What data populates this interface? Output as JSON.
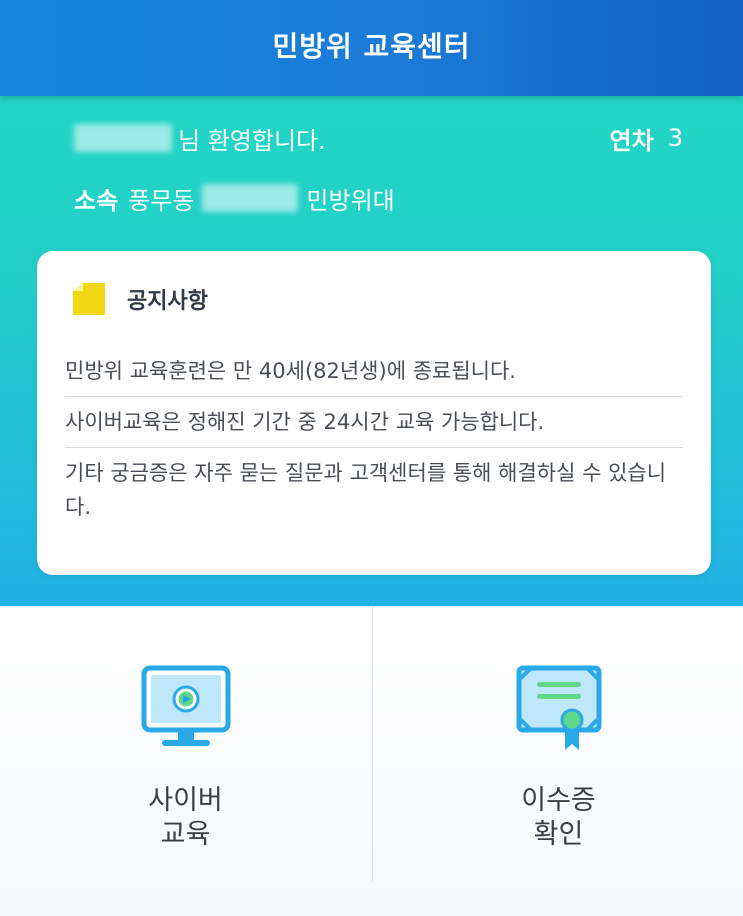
{
  "header": {
    "title": "민방위 교육센터"
  },
  "welcome": {
    "suffix": "님 환영합니다.",
    "year_label": "연차",
    "year_value": "3",
    "unit_prefix": "소속",
    "unit_location": "풍무동",
    "unit_suffix": "민방위대"
  },
  "notice": {
    "icon": "memo-icon",
    "title": "공지사항",
    "items": [
      "민방위 교육훈련은 만 40세(82년생)에 종료됩니다.",
      "사이버교육은 정해진 기간 중 24시간 교육 가능합니다.",
      "기타 궁금증은 자주 묻는 질문과 고객센터를 통해 해결하실 수 있습니다."
    ]
  },
  "menu": {
    "cyber": {
      "icon": "monitor-play-icon",
      "line1": "사이버",
      "line2": "교육"
    },
    "certificate": {
      "icon": "certificate-icon",
      "line1": "이수증",
      "line2": "확인"
    }
  },
  "colors": {
    "header_bg": "#1a7bd6",
    "hero_top": "#22d6c6",
    "hero_bottom": "#22b1e6",
    "icon_blue": "#29a9e8",
    "icon_green": "#5fd88a",
    "memo_yellow": "#f3d815"
  }
}
